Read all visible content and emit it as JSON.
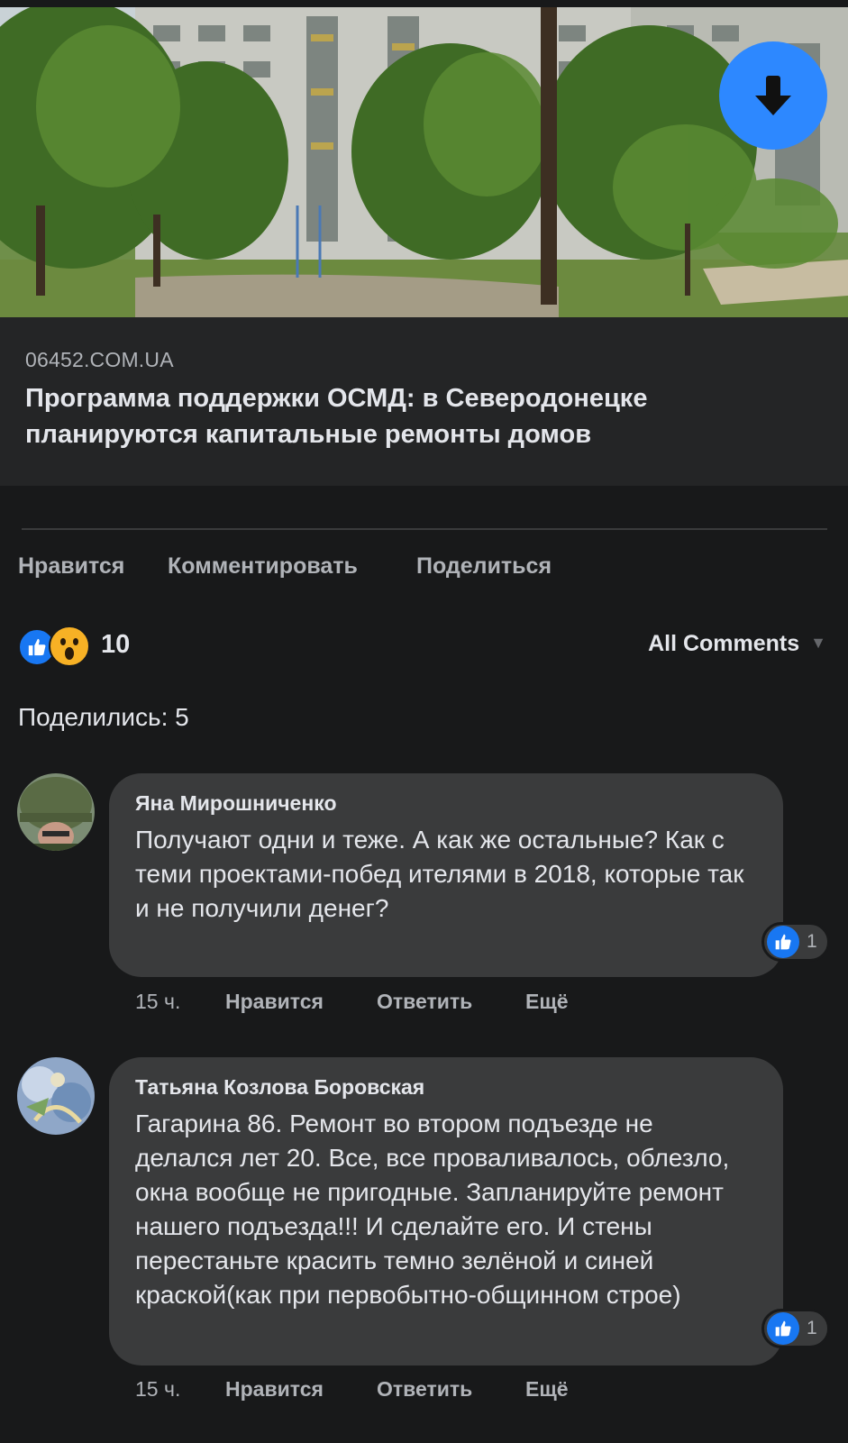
{
  "post": {
    "link_domain": "06452.COM.UA",
    "link_title": "Программа поддержки ОСМД: в Северодонецке планируются капитальные ремонты домов"
  },
  "actions": {
    "like": "Нравится",
    "comment": "Комментировать",
    "share": "Поделиться"
  },
  "reactions": {
    "count": "10",
    "types": [
      "like-icon",
      "wow-icon"
    ]
  },
  "comments_filter": "All Comments",
  "shares_text": "Поделились: 5",
  "comments": [
    {
      "author": "Яна Мирошниченко",
      "text": "Получают одни и теже. А как же остальные? Как с теми проектами-побед ителями в 2018, которые так и не получили денег?",
      "likes": "1",
      "time": "15 ч.",
      "like_label": "Нравится",
      "reply_label": "Ответить",
      "more_label": "Ещё"
    },
    {
      "author": "Татьяна Козлова Боровская",
      "text": "Гагарина 86. Ремонт во втором подъезде не делался лет 20. Все, все проваливалось, облезло, окна вообще не пригодные. Запланируйте ремонт нашего подъезда!!! И сделайте его. И стены перестаньте красить темно зелёной и синей краской(как при первобытно-общинном строе)",
      "likes": "1",
      "time": "15 ч.",
      "like_label": "Нравится",
      "reply_label": "Ответить",
      "more_label": "Ещё"
    }
  ],
  "colors": {
    "background": "#18191a",
    "card": "#242526",
    "bubble": "#3a3b3c",
    "accent": "#2d88ff",
    "like_blue": "#1877f2",
    "secondary_text": "#b0b3b8"
  },
  "icons": [
    "download-icon",
    "thumbs-up-icon",
    "wow-face-icon",
    "caret-down-icon"
  ]
}
